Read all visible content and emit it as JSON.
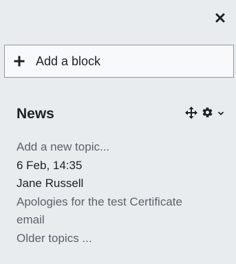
{
  "drawer": {
    "close_icon": "close-icon"
  },
  "add_block": {
    "icon": "plus-icon",
    "label": "Add a block"
  },
  "news_block": {
    "title": "News",
    "controls": [
      "move-icon",
      "gear-icon",
      "chevron-down-icon"
    ],
    "add_topic_label": "Add a new topic...",
    "post": {
      "date": "6 Feb, 14:35",
      "author": "Jane Russell",
      "subject": "Apologies for the test Certificate email"
    },
    "older_topics_label": "Older topics ..."
  }
}
